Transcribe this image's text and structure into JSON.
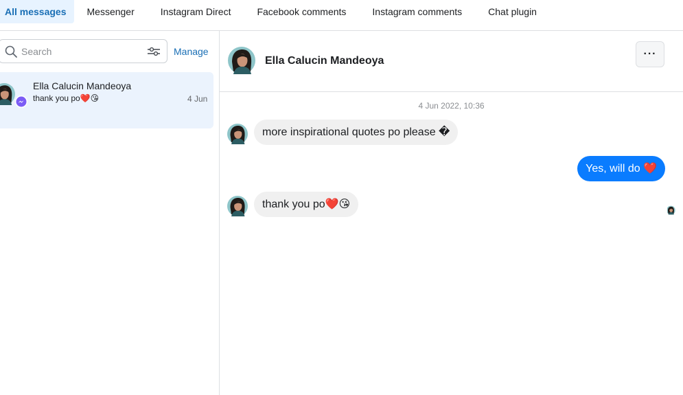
{
  "tabs": [
    {
      "label": "All messages",
      "active": true
    },
    {
      "label": "Messenger",
      "active": false
    },
    {
      "label": "Instagram Direct",
      "active": false
    },
    {
      "label": "Facebook comments",
      "active": false
    },
    {
      "label": "Instagram comments",
      "active": false
    },
    {
      "label": "Chat plugin",
      "active": false
    }
  ],
  "sidebar": {
    "search_placeholder": "Search",
    "manage_label": "Manage",
    "conversations": [
      {
        "name": "Ella Calucin Mandeoya",
        "preview": "thank you po❤️😘",
        "date": "4 Jun",
        "channel_icon": "messenger-icon"
      }
    ]
  },
  "chat": {
    "contact_name": "Ella Calucin Mandeoya",
    "more_label": "···",
    "timestamp": "4 Jun 2022, 10:36",
    "messages": [
      {
        "direction": "in",
        "text": "more inspirational quotes po please �"
      },
      {
        "direction": "out",
        "text": "Yes, will do ❤️"
      },
      {
        "direction": "in",
        "text": "thank you po❤️😘"
      }
    ]
  },
  "colors": {
    "accent": "#1a6fb5",
    "outgoing_bubble": "#0a7cff",
    "incoming_bubble": "#f0f0f0",
    "active_tab_bg": "#e7f3ff",
    "selected_row_bg": "#ebf3fd"
  }
}
